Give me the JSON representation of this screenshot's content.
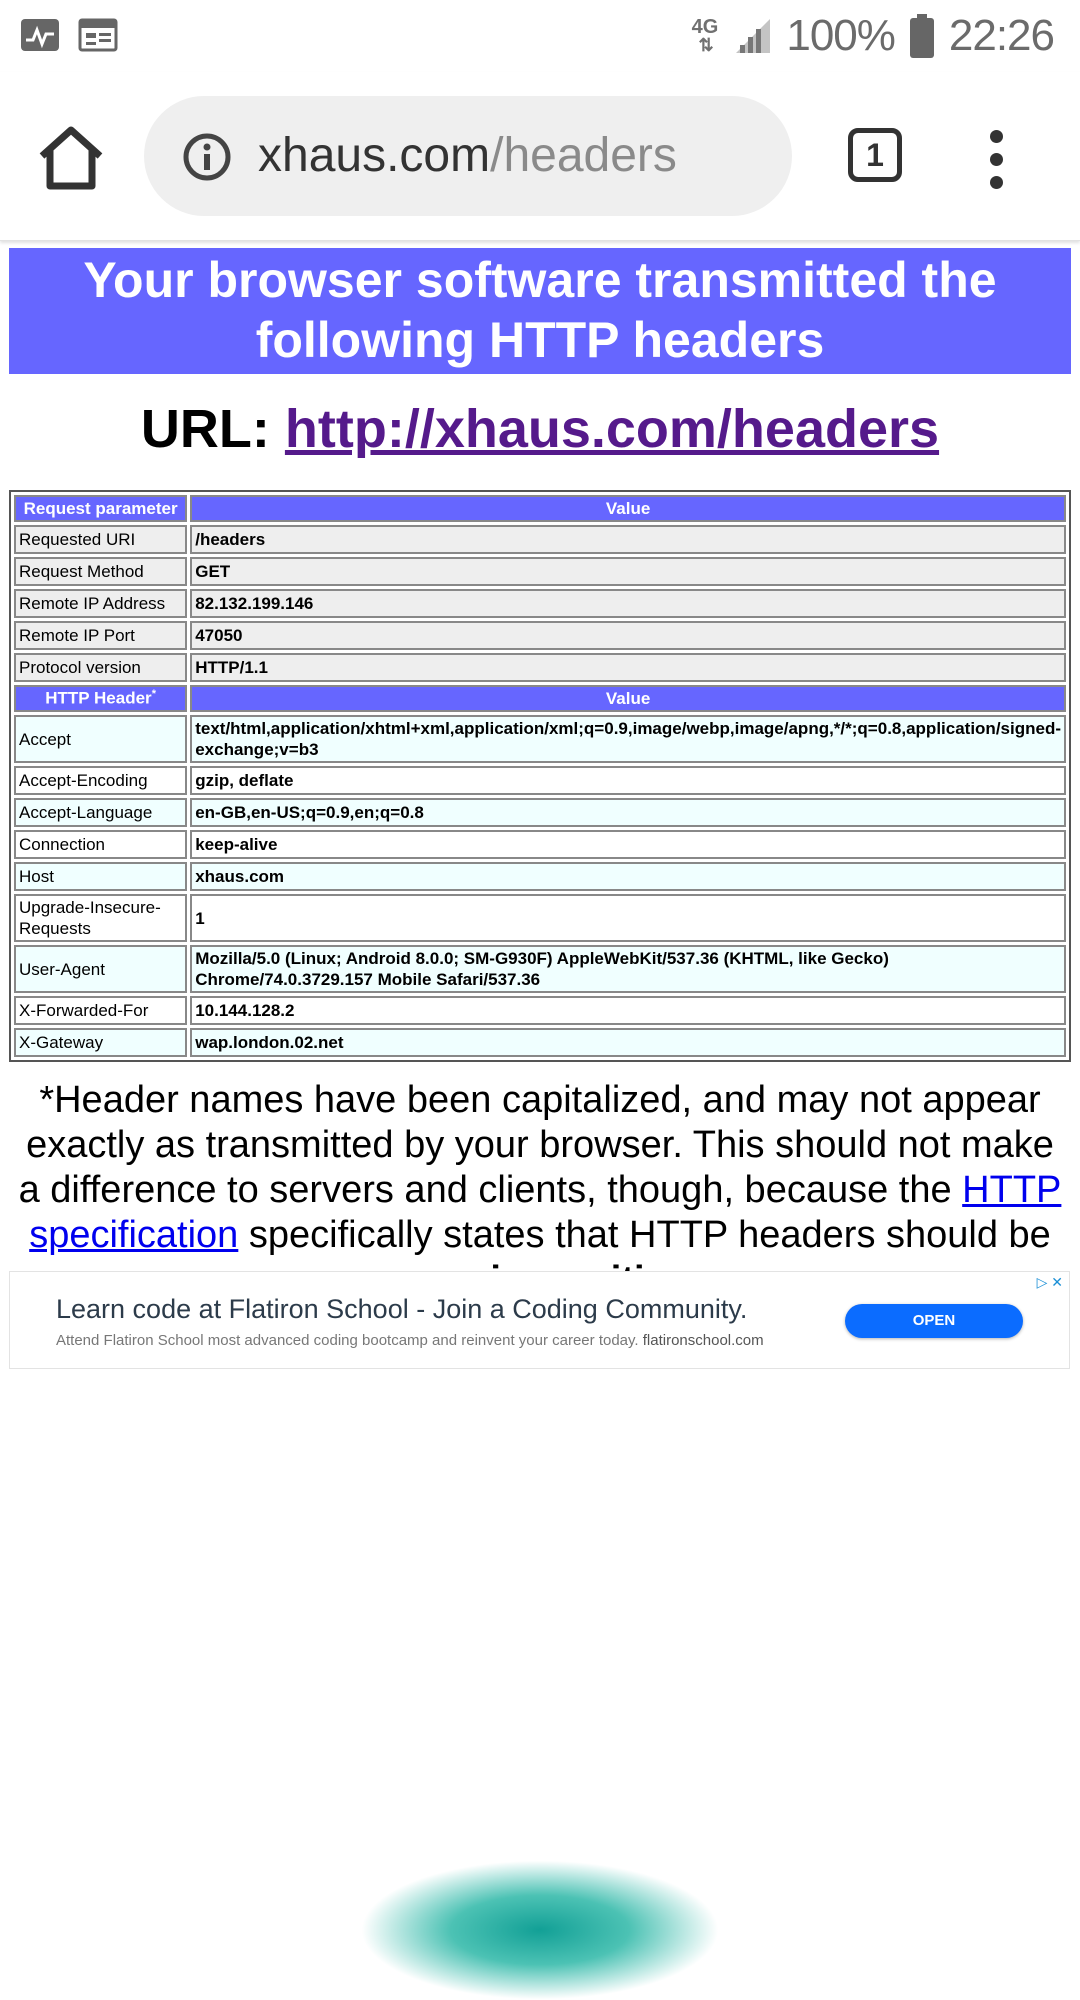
{
  "status_bar": {
    "network": "4G",
    "battery": "100%",
    "time": "22:26"
  },
  "browser": {
    "url_domain": "xhaus.com",
    "url_path": "/headers",
    "tab_count": "1"
  },
  "page": {
    "banner_title": "Your browser software transmitted the following HTTP headers",
    "url_label": "URL:",
    "url_link": "http://xhaus.com/headers",
    "request_header": {
      "param": "Request parameter",
      "value": "Value"
    },
    "request_rows": [
      {
        "key": "Requested URI",
        "value": "/headers"
      },
      {
        "key": "Request Method",
        "value": "GET"
      },
      {
        "key": "Remote IP Address",
        "value": "82.132.199.146"
      },
      {
        "key": "Remote IP Port",
        "value": "47050"
      },
      {
        "key": "Protocol version",
        "value": "HTTP/1.1"
      }
    ],
    "http_header": {
      "param": "HTTP Header",
      "mark": "*",
      "value": "Value"
    },
    "http_rows": [
      {
        "key": "Accept",
        "value": "text/html,application/xhtml+xml,application/xml;q=0.9,image/webp,image/apng,*/*;q=0.8,application/signed-exchange;v=b3"
      },
      {
        "key": "Accept-Encoding",
        "value": "gzip, deflate"
      },
      {
        "key": "Accept-Language",
        "value": "en-GB,en-US;q=0.9,en;q=0.8"
      },
      {
        "key": "Connection",
        "value": "keep-alive"
      },
      {
        "key": "Host",
        "value": "xhaus.com"
      },
      {
        "key": "Upgrade-Insecure-Requests",
        "value": "1"
      },
      {
        "key": "User-Agent",
        "value": "Mozilla/5.0 (Linux; Android 8.0.0; SM-G930F) AppleWebKit/537.36 (KHTML, like Gecko) Chrome/74.0.3729.157 Mobile Safari/537.36"
      },
      {
        "key": "X-Forwarded-For",
        "value": "10.144.128.2"
      },
      {
        "key": "X-Gateway",
        "value": "wap.london.02.net"
      }
    ],
    "note": {
      "before_link": "*Header names have been capitalized, and may not appear exactly as transmitted by your browser. This should not make a difference to servers and clients, though, because the ",
      "link": "HTTP specification",
      "after_link": " specifically states that HTTP headers should be ",
      "bold": "case-insensitive"
    }
  },
  "ad": {
    "title": "Learn code at Flatiron School - Join a Coding Community.",
    "description": "Attend Flatiron School most advanced coding bootcamp and reinvent your career today.",
    "domain": "flatironschool.com",
    "button": "OPEN",
    "choices_icon": "adchoices-icon",
    "close_icon": "close-icon"
  },
  "colors": {
    "banner": "#6666ff",
    "link_visited": "#551a8b",
    "link": "#0000ee",
    "ad_button": "#0b6cff"
  }
}
